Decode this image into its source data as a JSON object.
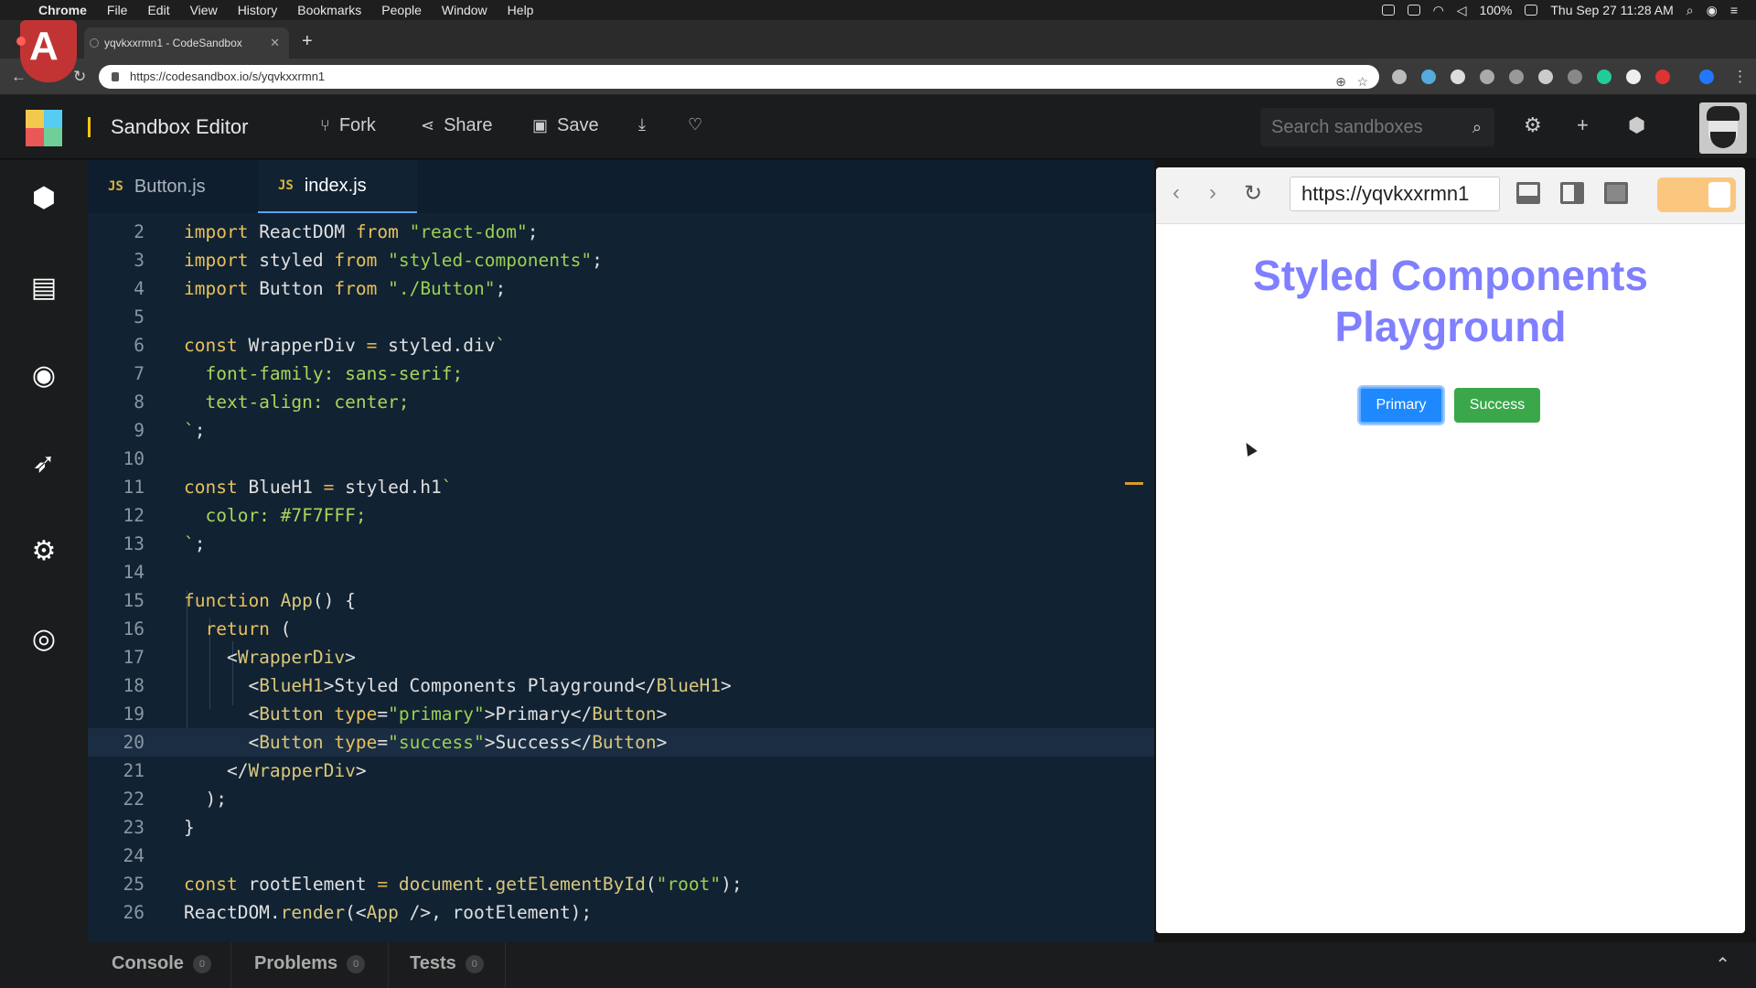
{
  "menubar": {
    "app": "Chrome",
    "items": [
      "File",
      "Edit",
      "View",
      "History",
      "Bookmarks",
      "People",
      "Window",
      "Help"
    ],
    "battery": "100%",
    "datetime": "Thu Sep 27  11:28 AM"
  },
  "browser": {
    "tab_title": "yqvkxxrmn1 - CodeSandbox",
    "url": "https://codesandbox.io/s/yqvkxxrmn1"
  },
  "app": {
    "title": "Sandbox Editor",
    "fork": "Fork",
    "share": "Share",
    "save": "Save",
    "search_placeholder": "Search sandboxes"
  },
  "editor": {
    "tabs": [
      {
        "label": "Button.js",
        "badge": "JS"
      },
      {
        "label": "index.js",
        "badge": "JS"
      }
    ],
    "active_tab": "index.js",
    "highlighted_line": 20
  },
  "console": {
    "tabs": [
      {
        "label": "Console",
        "count": "0"
      },
      {
        "label": "Problems",
        "count": "0"
      },
      {
        "label": "Tests",
        "count": "0"
      }
    ]
  },
  "preview": {
    "url": "https://yqvkxxrmn1",
    "heading_line1": "Styled Components",
    "heading_line2": "Playground",
    "heading_color": "#7F7FFF",
    "primary_button": "Primary",
    "success_button": "Success"
  },
  "colors": {
    "editor_bg": "#112233",
    "keyword": "#e8c15a",
    "string": "#9ad04f",
    "primary": "#1e88ff",
    "success": "#3aa84a"
  }
}
